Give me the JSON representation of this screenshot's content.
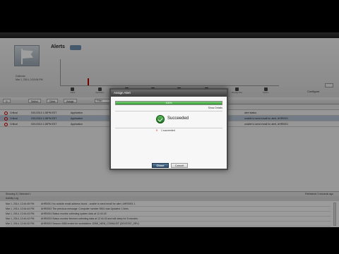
{
  "header": {
    "title": "Alerts",
    "collector_label": "Collector",
    "collector_time": "Mar 1, 2014, 2:02:06 PM",
    "configure_label": "Configure"
  },
  "chart_icons": [
    "Failed",
    "Application",
    "Group",
    "System",
    "Service",
    "Filesystem",
    "Message Bus",
    "System"
  ],
  "stats": [
    {
      "label": "Active",
      "value": "0 Sev 3"
    },
    {
      "label": "Sev/Hrs",
      "value": "0 Sev 3"
    },
    {
      "label": "Status Unread",
      "value": "7 active"
    }
  ],
  "toolbar": {
    "refresh_label": "↻",
    "select_label": "Select",
    "clear_label": "Clear",
    "assign_label": "Assign",
    "filter_label": "Filter"
  },
  "rows": [
    {
      "sev": "Critical",
      "time": "03/1/2014 1:26PM EST",
      "type": "Application",
      "msg": "alert status"
    },
    {
      "sev": "Critical",
      "time": "03/1/2014 1:26PM EST",
      "type": "Application",
      "msg": "unable to send email for alert, AHR0001"
    },
    {
      "sev": "Critical",
      "time": "03/1/2014 1:26PM EST",
      "type": "Application",
      "msg": "unable to send email for alert, AHR0001"
    }
  ],
  "statusbar": {
    "left": "Showing 3  |  Selected 1",
    "right": "Refreshed 3 seconds ago"
  },
  "log_title": "Activity Log",
  "log": [
    {
      "time": "Mar 1, 2014, 12:44:45 PM",
      "msg": "AHR0001 No outside email address found - unable to send email for alert, AHR0001 1"
    },
    {
      "time": "Mar 1, 2014, 12:44:44 PM",
      "msg": "AHR0003 The previous message: Computer number 5461 was Updated: 1 lines"
    },
    {
      "time": "Mar 1, 2014, 12:44:43 PM",
      "msg": "AHR0004 Status monitor collecting system data at 12:44:43"
    },
    {
      "time": "Mar 1, 2014, 12:44:43 PM",
      "msg": "AHR0003 Status monitor finished collecting data at 12:44:43 and will sleep for 5 minutes."
    },
    {
      "time": "Mar 1, 2014, 12:44:32 PM",
      "msg": "AHR0003 Sesson 4565 ended for workstation JOBS_NEW_CONNLIST (DEVSTAT_SRV)"
    }
  ],
  "dialog": {
    "title": "Assign Alert",
    "progress": 100,
    "progress_label": "100%",
    "show_details": "Show Details",
    "status": "Succeeded",
    "summary_failed": "0",
    "summary_succeeded": "1 succeeded",
    "ok_label": "Close",
    "cancel_label": "Cancel"
  }
}
